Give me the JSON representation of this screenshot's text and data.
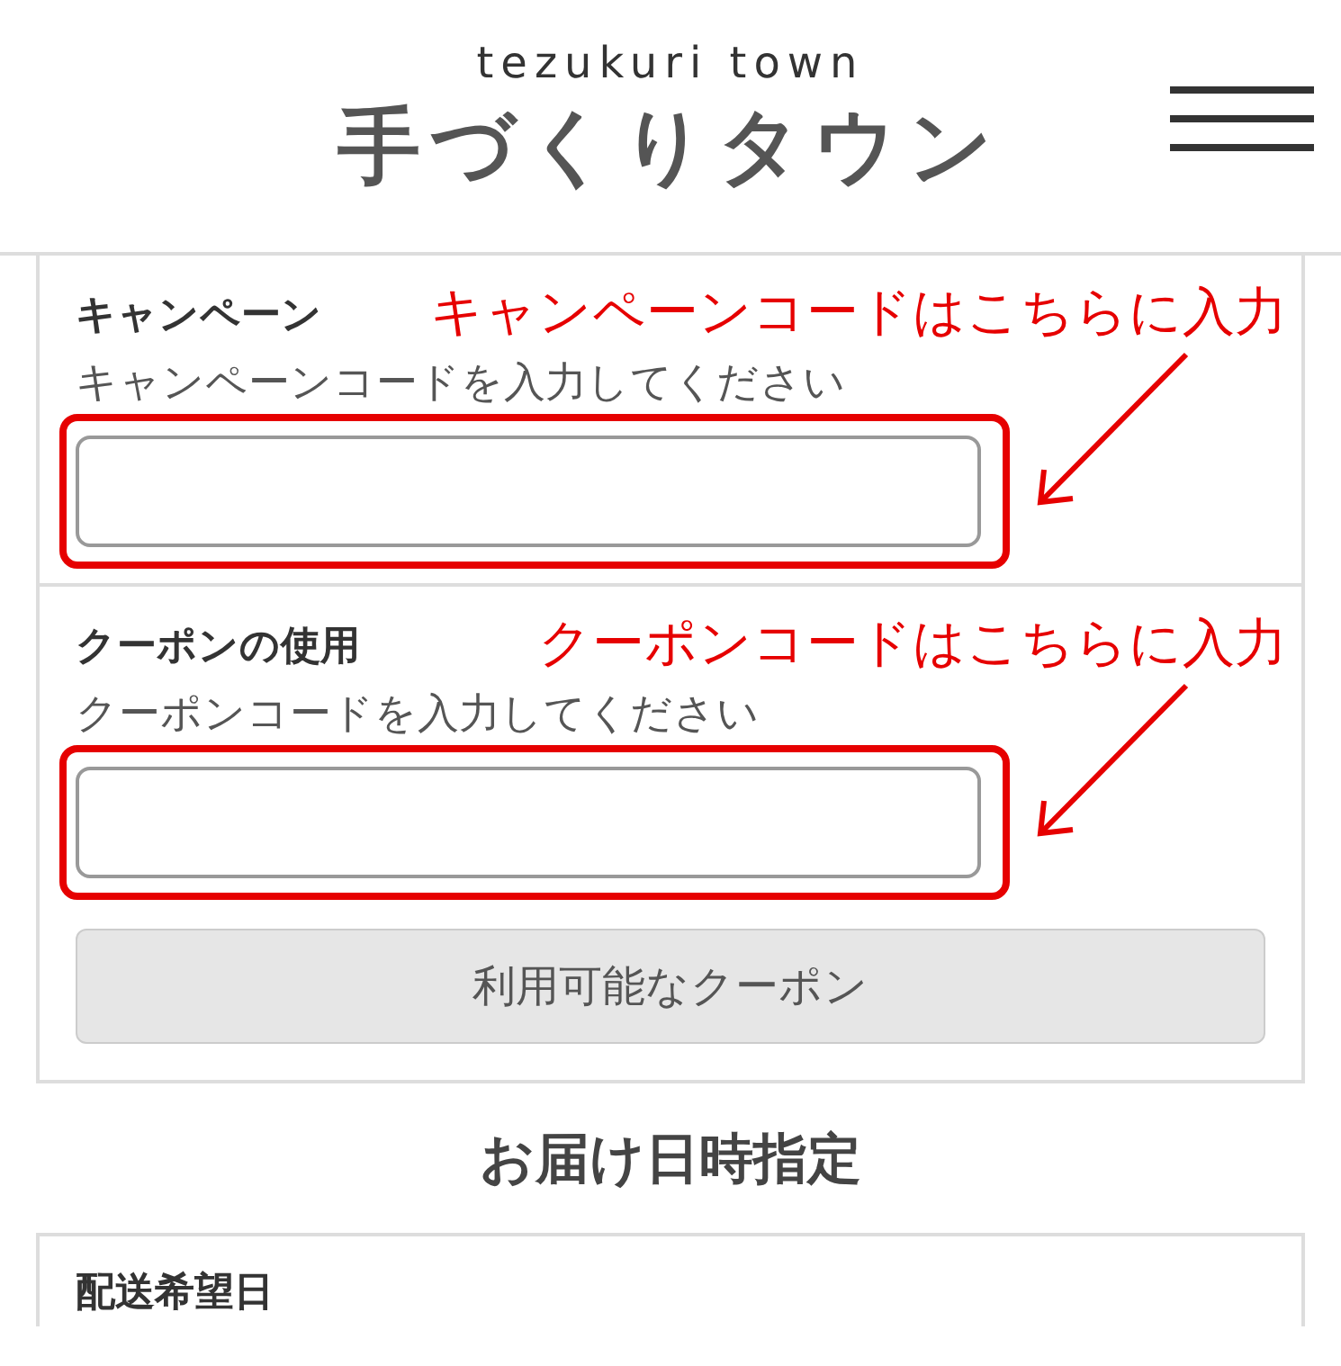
{
  "header": {
    "subtitle": "tezukuri town",
    "logo": "手づくりタウン"
  },
  "code_sections": [
    {
      "label": "キャンペーン",
      "hint": "キャンペーンコードを入力してください",
      "annotation": "キャンペーンコードはこちらに入力"
    },
    {
      "label": "クーポンの使用",
      "hint": "クーポンコードを入力してください",
      "annotation": "クーポンコードはこちらに入力",
      "button": "利用可能なクーポン"
    }
  ],
  "delivery": {
    "heading": "お届け日時指定",
    "field_label": "配送希望日"
  }
}
